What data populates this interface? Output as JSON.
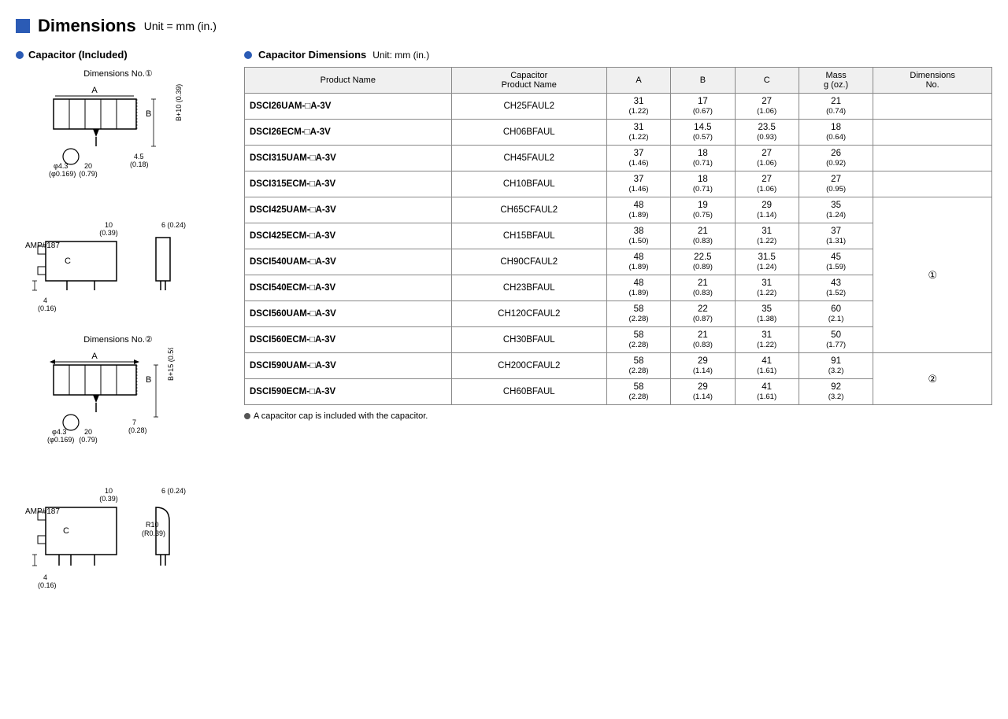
{
  "page": {
    "title": "Dimensions",
    "unit_label": "Unit = mm (in.)",
    "left_section_title": "Capacitor (Included)",
    "right_section_title": "Capacitor Dimensions",
    "right_section_unit": "Unit: mm (in.)",
    "footnote": "A capacitor cap is included with the capacitor."
  },
  "diagrams": [
    {
      "label": "Dimensions No.①",
      "type": "1"
    },
    {
      "label": "Dimensions No.②",
      "type": "2"
    }
  ],
  "table": {
    "headers": [
      "Product Name",
      "Capacitor\nProduct Name",
      "A",
      "B",
      "C",
      "Mass\ng (oz.)",
      "Dimensions\nNo."
    ],
    "rows": [
      {
        "product_name": "DSCI26UAM-□A-3V",
        "cap_product": "CH25FAUL2",
        "a": "31\n(1.22)",
        "b": "17\n(0.67)",
        "c": "27\n(1.06)",
        "mass": "21\n(0.74)",
        "dim_no": ""
      },
      {
        "product_name": "DSCI26ECM-□A-3V",
        "cap_product": "CH06BFAUL",
        "a": "31\n(1.22)",
        "b": "14.5\n(0.57)",
        "c": "23.5\n(0.93)",
        "mass": "18\n(0.64)",
        "dim_no": ""
      },
      {
        "product_name": "DSCI315UAM-□A-3V",
        "cap_product": "CH45FAUL2",
        "a": "37\n(1.46)",
        "b": "18\n(0.71)",
        "c": "27\n(1.06)",
        "mass": "26\n(0.92)",
        "dim_no": ""
      },
      {
        "product_name": "DSCI315ECM-□A-3V",
        "cap_product": "CH10BFAUL",
        "a": "37\n(1.46)",
        "b": "18\n(0.71)",
        "c": "27\n(1.06)",
        "mass": "27\n(0.95)",
        "dim_no": ""
      },
      {
        "product_name": "DSCI425UAM-□A-3V",
        "cap_product": "CH65CFAUL2",
        "a": "48\n(1.89)",
        "b": "19\n(0.75)",
        "c": "29\n(1.14)",
        "mass": "35\n(1.24)",
        "dim_no": "①",
        "dim_rowspan": 8
      },
      {
        "product_name": "DSCI425ECM-□A-3V",
        "cap_product": "CH15BFAUL",
        "a": "38\n(1.50)",
        "b": "21\n(0.83)",
        "c": "31\n(1.22)",
        "mass": "37\n(1.31)",
        "dim_no": ""
      },
      {
        "product_name": "DSCI540UAM-□A-3V",
        "cap_product": "CH90CFAUL2",
        "a": "48\n(1.89)",
        "b": "22.5\n(0.89)",
        "c": "31.5\n(1.24)",
        "mass": "45\n(1.59)",
        "dim_no": ""
      },
      {
        "product_name": "DSCI540ECM-□A-3V",
        "cap_product": "CH23BFAUL",
        "a": "48\n(1.89)",
        "b": "21\n(0.83)",
        "c": "31\n(1.22)",
        "mass": "43\n(1.52)",
        "dim_no": ""
      },
      {
        "product_name": "DSCI560UAM-□A-3V",
        "cap_product": "CH120CFAUL2",
        "a": "58\n(2.28)",
        "b": "22\n(0.87)",
        "c": "35\n(1.38)",
        "mass": "60\n(2.1)",
        "dim_no": ""
      },
      {
        "product_name": "DSCI560ECM-□A-3V",
        "cap_product": "CH30BFAUL",
        "a": "58\n(2.28)",
        "b": "21\n(0.83)",
        "c": "31\n(1.22)",
        "mass": "50\n(1.77)",
        "dim_no": ""
      },
      {
        "product_name": "DSCI590UAM-□A-3V",
        "cap_product": "CH200CFAUL2",
        "a": "58\n(2.28)",
        "b": "29\n(1.14)",
        "c": "41\n(1.61)",
        "mass": "91\n(3.2)",
        "dim_no": "②",
        "dim_rowspan": 2
      },
      {
        "product_name": "DSCI590ECM-□A-3V",
        "cap_product": "CH60BFAUL",
        "a": "58\n(2.28)",
        "b": "29\n(1.14)",
        "c": "41\n(1.61)",
        "mass": "92\n(3.2)",
        "dim_no": ""
      }
    ]
  }
}
